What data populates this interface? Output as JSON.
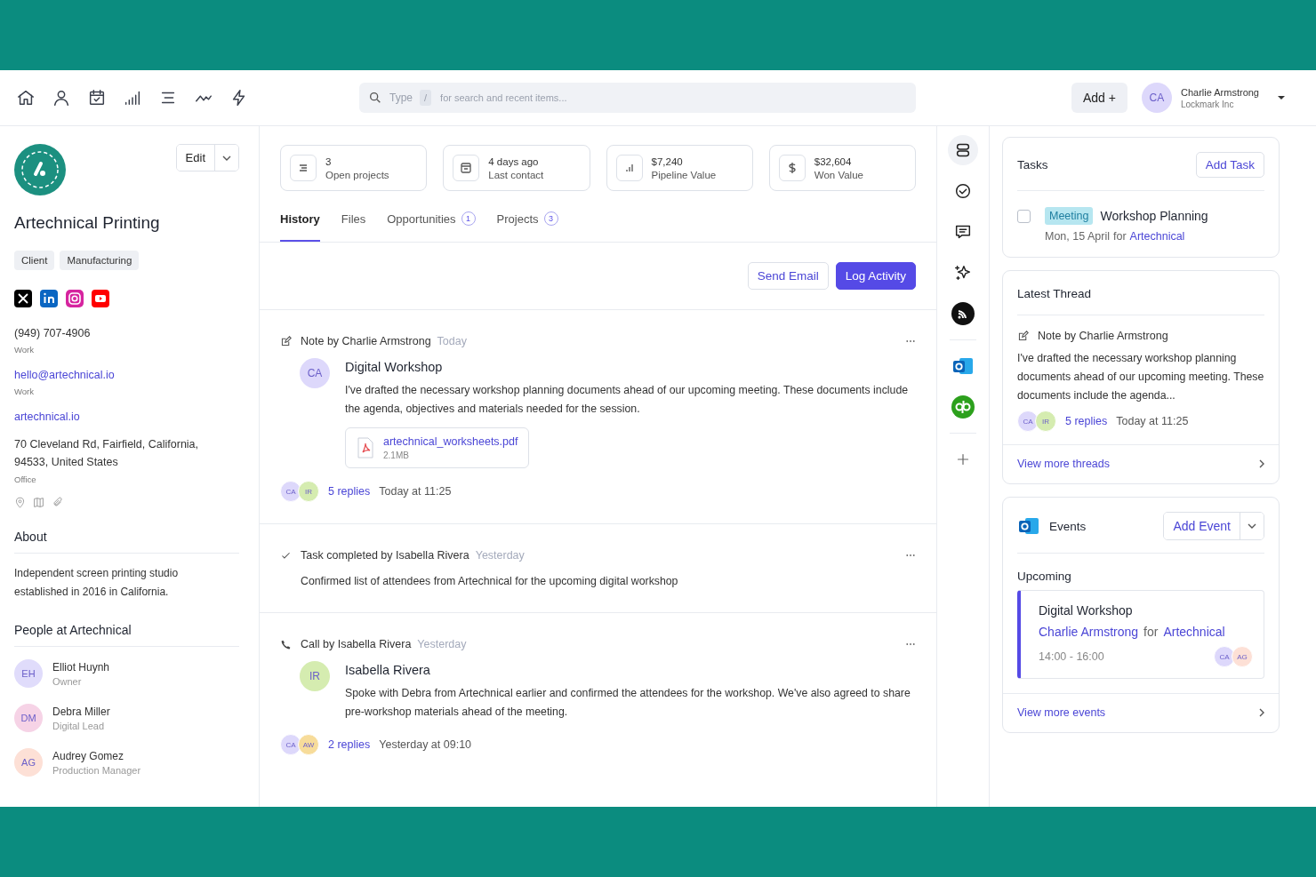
{
  "search": {
    "prefix": "Type",
    "key": "/",
    "placeholder": "for search and recent items..."
  },
  "add_button": "Add +",
  "user": {
    "initials": "CA",
    "color": "#ddd8fb",
    "name": "Charlie Armstrong",
    "company": "Lockmark Inc"
  },
  "company": {
    "name": "Artechnical Printing",
    "edit": "Edit",
    "tags": [
      "Client",
      "Manufacturing"
    ],
    "phone": "(949) 707-4906",
    "phone_label": "Work",
    "email": "hello@artechnical.io",
    "email_label": "Work",
    "website": "artechnical.io",
    "address": "70 Cleveland Rd, Fairfield, California, 94533, United States",
    "address_label": "Office",
    "about_title": "About",
    "about": "Independent screen printing studio established in 2016 in California.",
    "people_title": "People at Artechnical",
    "people": [
      {
        "initials": "EH",
        "name": "Elliot Huynh",
        "role": "Owner",
        "color": "#e0dcfb"
      },
      {
        "initials": "DM",
        "name": "Debra Miller",
        "role": "Digital Lead",
        "color": "#f6d3e6"
      },
      {
        "initials": "AG",
        "name": "Audrey Gomez",
        "role": "Production Manager",
        "color": "#fde0d6"
      }
    ]
  },
  "stats": [
    {
      "kind": "projects",
      "value": "3",
      "label": "Open projects"
    },
    {
      "kind": "calendar",
      "value": "4 days ago",
      "label": "Last contact"
    },
    {
      "kind": "chart",
      "value": "$7,240",
      "label": "Pipeline Value"
    },
    {
      "kind": "dollar",
      "value": "$32,604",
      "label": "Won Value"
    }
  ],
  "tabs": [
    {
      "label": "History",
      "selected": true
    },
    {
      "label": "Files",
      "selected": false
    },
    {
      "label": "Opportunities",
      "count": "1",
      "selected": false
    },
    {
      "label": "Projects",
      "count": "3",
      "selected": false
    }
  ],
  "actions": {
    "secondary": "Send Email",
    "primary": "Log Activity"
  },
  "activities": [
    {
      "kind": "note",
      "header": "Note by Charlie Armstrong",
      "when": "Today",
      "avatar": {
        "initials": "CA",
        "color": "#ddd8fb"
      },
      "title": "Digital Workshop",
      "body": "I've drafted the necessary workshop planning documents ahead of our upcoming meeting. These documents include the agenda, objectives and materials needed for the session.",
      "attachment": {
        "name": "artechnical_worksheets.pdf",
        "size": "2.1MB"
      },
      "replies": {
        "avatars": [
          {
            "initials": "CA",
            "color": "#ddd8fb"
          },
          {
            "initials": "IR",
            "color": "#d5ecb0"
          }
        ],
        "count": "5 replies",
        "time": "Today at 11:25"
      }
    },
    {
      "kind": "task",
      "header": "Task completed by Isabella Rivera",
      "when": "Yesterday",
      "body": "Confirmed list of attendees from Artechnical for the upcoming digital workshop"
    },
    {
      "kind": "call",
      "header": "Call by Isabella Rivera",
      "when": "Yesterday",
      "avatar": {
        "initials": "IR",
        "color": "#d5ecb0"
      },
      "title": "Isabella Rivera",
      "body": "Spoke with Debra from Artechnical earlier and confirmed the attendees for the workshop. We've also agreed to share pre-workshop materials ahead of the meeting.",
      "replies": {
        "avatars": [
          {
            "initials": "CA",
            "color": "#ddd8fb"
          },
          {
            "initials": "AW",
            "color": "#f7dc9a"
          }
        ],
        "count": "2 replies",
        "time": "Yesterday at 09:10"
      }
    }
  ],
  "rail": [
    {
      "kind": "stack",
      "selected": true
    },
    {
      "kind": "check",
      "selected": false
    },
    {
      "kind": "chat",
      "selected": false
    },
    {
      "kind": "sparkle",
      "selected": false
    },
    {
      "kind": "feed",
      "selected": false
    },
    {
      "kind": "outlook",
      "selected": false
    },
    {
      "kind": "quickbooks",
      "selected": false
    },
    {
      "kind": "plus",
      "selected": false
    }
  ],
  "tasks": {
    "title": "Tasks",
    "add": "Add Task",
    "items": [
      {
        "tag": "Meeting",
        "title": "Workshop Planning",
        "date": "Mon, 15 April",
        "for": "for",
        "link": "Artechnical",
        "checked": false
      }
    ]
  },
  "thread": {
    "title": "Latest Thread",
    "header": "Note by Charlie Armstrong",
    "body": "I've drafted the necessary workshop planning documents ahead of our upcoming meeting. These documents include the agenda...",
    "replies": {
      "avatars": [
        {
          "initials": "CA",
          "color": "#ddd8fb"
        },
        {
          "initials": "IR",
          "color": "#d5ecb0"
        }
      ],
      "count": "5 replies",
      "time": "Today at 11:25"
    },
    "more": "View more threads"
  },
  "events": {
    "title": "Events",
    "add": "Add Event",
    "section": "Upcoming",
    "items": [
      {
        "title": "Digital Workshop",
        "organizer": "Charlie Armstrong",
        "for": "for",
        "company": "Artechnical",
        "time": "14:00 - 16:00",
        "avatars": [
          {
            "initials": "CA",
            "color": "#ddd8fb"
          },
          {
            "initials": "AG",
            "color": "#fde0d6"
          }
        ]
      }
    ],
    "more": "View more events"
  }
}
